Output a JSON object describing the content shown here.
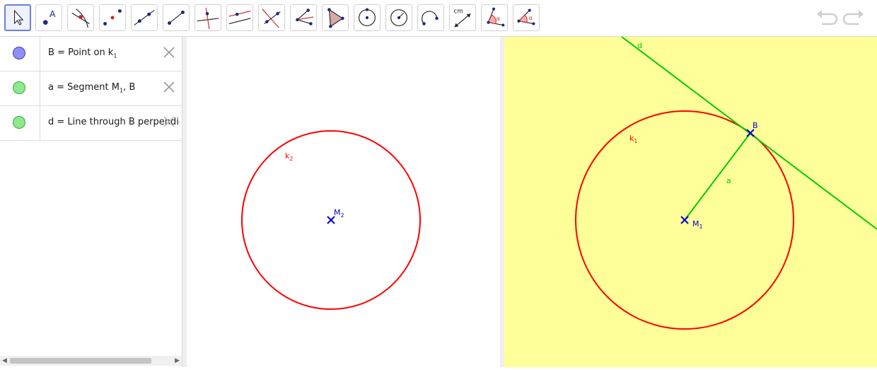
{
  "toolbar": {
    "tools": [
      {
        "id": "move",
        "icon": "move-arrow-icon",
        "selected": true
      },
      {
        "id": "point",
        "icon": "point-icon",
        "label": "A"
      },
      {
        "id": "intersect",
        "icon": "intersect-icon"
      },
      {
        "id": "midpoint",
        "icon": "midpoint-icon"
      },
      {
        "id": "line",
        "icon": "line-icon"
      },
      {
        "id": "segment",
        "icon": "segment-icon"
      },
      {
        "id": "perpendicular",
        "icon": "perpendicular-line-icon"
      },
      {
        "id": "parallel",
        "icon": "parallel-line-icon"
      },
      {
        "id": "bisector",
        "icon": "perpendicular-bisector-icon"
      },
      {
        "id": "angle-bisector",
        "icon": "angle-bisector-icon"
      },
      {
        "id": "polygon",
        "icon": "polygon-icon"
      },
      {
        "id": "circle-center-point",
        "icon": "circle-center-point-icon"
      },
      {
        "id": "circle-center-radius",
        "icon": "circle-radius-icon"
      },
      {
        "id": "arc",
        "icon": "semicircle-icon"
      },
      {
        "id": "distance",
        "icon": "distance-icon",
        "label": "cm"
      },
      {
        "id": "angle",
        "icon": "angle-icon",
        "label": "α"
      },
      {
        "id": "angle-size",
        "icon": "angle-given-size-icon",
        "label": "α"
      }
    ],
    "undo_icon": "undo-icon",
    "redo_icon": "redo-icon"
  },
  "algebra": {
    "rows": [
      {
        "color": "#8f8ff5",
        "border": "#3c3ccc",
        "text": "B = Point on k",
        "sub": "1"
      },
      {
        "color": "#8fe88f",
        "border": "#3aa83a",
        "text": "a = Segment M",
        "sub": "1",
        "suffix": ", B"
      },
      {
        "color": "#8fe88f",
        "border": "#3aa83a",
        "text": "d = Line through B perpendicular to a"
      }
    ],
    "delete_icon": "close-icon"
  },
  "graphics1": {
    "circle_label": "k",
    "circle_label_sub": "2",
    "center_label": "M",
    "center_label_sub": "2",
    "circle_color": "#ff0000",
    "point_color": "#0000cc"
  },
  "graphics2": {
    "background": "#ffff99",
    "circle_label": "k",
    "circle_label_sub": "1",
    "center_label": "M",
    "center_label_sub": "1",
    "point_b_label": "B",
    "segment_label": "a",
    "line_label": "d",
    "circle_color": "#ff0000",
    "point_color": "#0000cc",
    "line_color": "#00cc00"
  }
}
